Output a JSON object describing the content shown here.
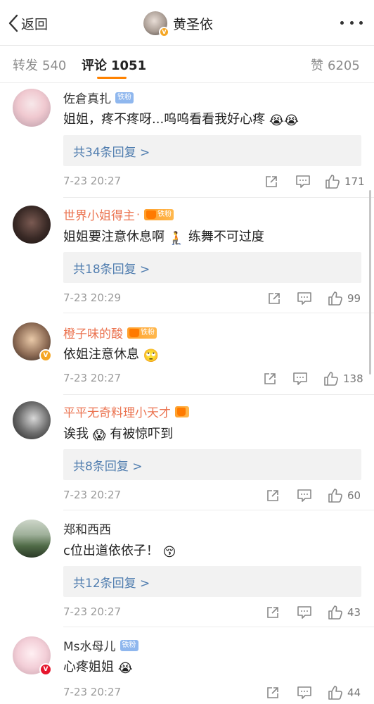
{
  "header": {
    "back_label": "返回",
    "title": "黄圣依"
  },
  "tabs": {
    "repost_label": "转发",
    "repost_count": "540",
    "comment_label": "评论",
    "comment_count": "1051",
    "like_label": "赞",
    "like_count": "6205"
  },
  "accent_color": "#ff8200",
  "comments": [
    {
      "user": "佐倉真扎",
      "tag": "铁粉",
      "text": "姐姐，疼不疼呀...呜呜看看我好心疼",
      "emoji": "😭😭",
      "replies": "共34条回复 >",
      "time": "7-23 20:27",
      "likes": "171"
    },
    {
      "user": "世界小姐得主",
      "tag": "铁粉",
      "text_a": "姐姐要注意休息啊",
      "emoji": "🧎",
      "text_b": "练舞不可过度",
      "replies": "共18条回复 >",
      "time": "7-23 20:29",
      "likes": "99"
    },
    {
      "user": "橙子味的酸",
      "tag": "铁粉",
      "text": "依姐注意休息",
      "emoji": "🙄",
      "time": "7-23 20:27",
      "likes": "138"
    },
    {
      "user": "平平无奇料理小天才",
      "text_a": "诶我",
      "emoji": "😱",
      "text_b": "有被惊吓到",
      "replies": "共8条回复 >",
      "time": "7-23 20:27",
      "likes": "60"
    },
    {
      "user": "郑和西西",
      "text": "c位出道依依子！",
      "emoji": "😚",
      "replies": "共12条回复 >",
      "time": "7-23 20:27",
      "likes": "43"
    },
    {
      "user": "Ms水母儿",
      "tag": "铁粉",
      "text": "心疼姐姐",
      "emoji": "😭",
      "time": "7-23 20:27",
      "likes": "44"
    }
  ]
}
